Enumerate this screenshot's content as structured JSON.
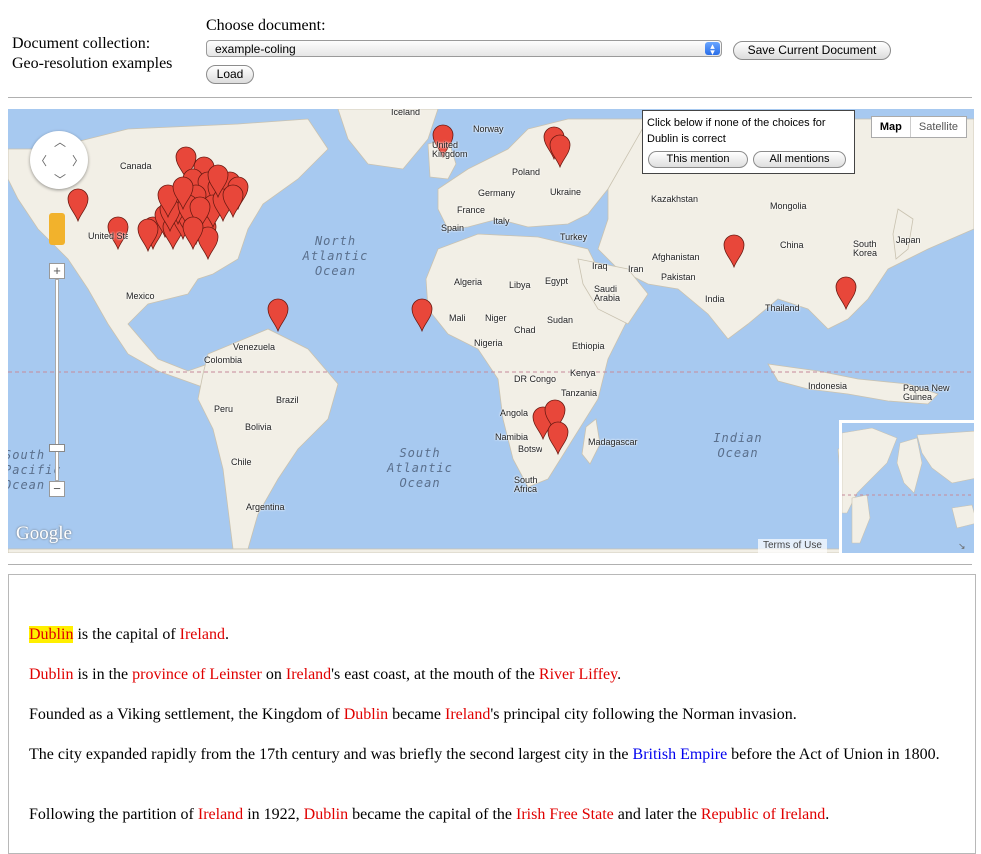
{
  "header": {
    "collection_line1": "Document collection:",
    "collection_line2": "Geo-resolution examples",
    "choose_label": "Choose document:",
    "selected_document": "example-coling",
    "save_button": "Save Current Document",
    "load_button": "Load"
  },
  "map": {
    "map_type_selected": "Map",
    "map_type_other": "Satellite",
    "info_text": "Click below if none of the choices for Dublin is correct",
    "info_this_mention": "This mention",
    "info_all_mentions": "All mentions",
    "logo": "Google",
    "terms": "Terms of Use",
    "zoom_in": "+",
    "zoom_out": "−",
    "country_labels": [
      "Iceland",
      "Norway",
      "United Kingdom",
      "Poland",
      "Germany",
      "Ukraine",
      "France",
      "Italy",
      "Spain",
      "Turkey",
      "Kazakhstan",
      "Mongolia",
      "China",
      "South Korea",
      "Japan",
      "Canada",
      "United States",
      "Mexico",
      "Venezuela",
      "Colombia",
      "Brazil",
      "Peru",
      "Bolivia",
      "Chile",
      "Argentina",
      "Algeria",
      "Libya",
      "Egypt",
      "Mali",
      "Niger",
      "Chad",
      "Sudan",
      "Nigeria",
      "Ethiopia",
      "DR Congo",
      "Kenya",
      "Tanzania",
      "Angola",
      "Namibia",
      "Botswana",
      "South Africa",
      "Madagascar",
      "Saudi Arabia",
      "Iraq",
      "Iran",
      "Afghanistan",
      "Pakistan",
      "India",
      "Thailand",
      "Indonesia",
      "Papua New Guinea"
    ],
    "ocean_labels": [
      "North Atlantic Ocean",
      "South Atlantic Ocean",
      "Indian Ocean",
      "South Pacific Ocean"
    ],
    "marker_color": "#e8473a",
    "marker_count": 40
  },
  "text": {
    "p1": [
      {
        "t": "Dublin",
        "c": "hl"
      },
      {
        "t": " is the capital of ",
        "c": ""
      },
      {
        "t": "Ireland",
        "c": "r"
      },
      {
        "t": ".",
        "c": ""
      }
    ],
    "p2": [
      {
        "t": "Dublin",
        "c": "r"
      },
      {
        "t": " is in the ",
        "c": ""
      },
      {
        "t": "province of Leinster",
        "c": "r"
      },
      {
        "t": " on ",
        "c": ""
      },
      {
        "t": "Ireland",
        "c": "r"
      },
      {
        "t": "'s east coast, at the mouth of the ",
        "c": ""
      },
      {
        "t": "River Liffey",
        "c": "r"
      },
      {
        "t": ".",
        "c": ""
      }
    ],
    "p3": [
      {
        "t": "Founded as a Viking settlement, the Kingdom of ",
        "c": ""
      },
      {
        "t": "Dublin",
        "c": "r"
      },
      {
        "t": " became ",
        "c": ""
      },
      {
        "t": "Ireland",
        "c": "r"
      },
      {
        "t": "'s principal city following the Norman invasion.",
        "c": ""
      }
    ],
    "p4": [
      {
        "t": "The city expanded rapidly from the 17th century and was briefly the second largest city in the ",
        "c": ""
      },
      {
        "t": "British Empire",
        "c": "b"
      },
      {
        "t": " before the Act of Union in 1800.",
        "c": ""
      }
    ],
    "p5": [
      {
        "t": "Following the partition of ",
        "c": ""
      },
      {
        "t": "Ireland",
        "c": "r"
      },
      {
        "t": " in 1922, ",
        "c": ""
      },
      {
        "t": "Dublin",
        "c": "r"
      },
      {
        "t": " became the capital of the ",
        "c": ""
      },
      {
        "t": "Irish Free State",
        "c": "r"
      },
      {
        "t": " and later the ",
        "c": ""
      },
      {
        "t": "Republic of Ireland",
        "c": "r"
      },
      {
        "t": ".",
        "c": ""
      }
    ]
  }
}
